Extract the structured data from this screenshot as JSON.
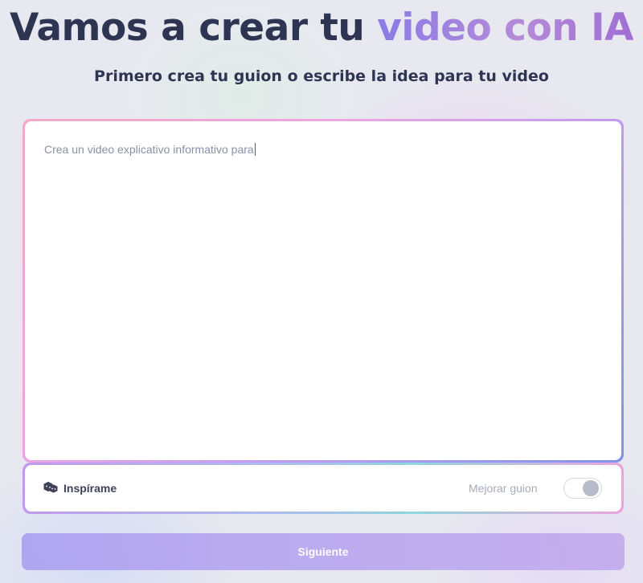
{
  "header": {
    "title_main": "Vamos a crear tu",
    "title_accent": "video con IA",
    "subtitle": "Primero crea tu guion o escribe la idea para tu video"
  },
  "editor": {
    "value": "Crea un video explicativo informativo para"
  },
  "options": {
    "inspire_icon": "dice-icon",
    "inspire_label": "Inspírame",
    "improve_label": "Mejorar guion",
    "improve_enabled": false
  },
  "footer": {
    "next_label": "Siguiente"
  },
  "colors": {
    "heading": "#2e3553",
    "accent_start": "#8a7be6",
    "accent_end": "#a06fd4",
    "button": "#b7a6ef"
  }
}
